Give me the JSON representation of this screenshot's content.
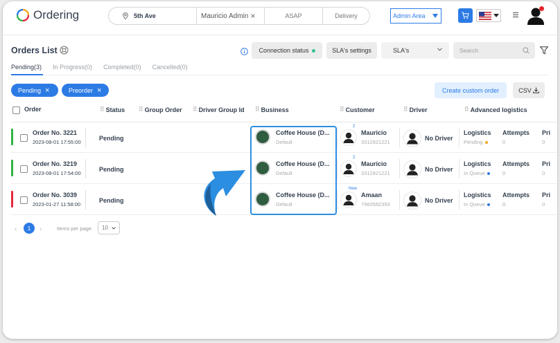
{
  "app": {
    "name": "Ordering"
  },
  "searchbar": {
    "address": "5th Ave",
    "user": "Mauricio Admin",
    "time": "ASAP",
    "delivery": "Delivery"
  },
  "admin_area": {
    "label": "Admin Area"
  },
  "page": {
    "title": "Orders List",
    "connection_status": "Connection status",
    "sla_settings": "SLA's settings",
    "sla_select": "SLA's",
    "search_placeholder": "Search"
  },
  "tabs": [
    {
      "label": "Pending(3)",
      "active": true
    },
    {
      "label": "In Progress(0)",
      "active": false
    },
    {
      "label": "Completed(0)",
      "active": false
    },
    {
      "label": "Cancelled(0)",
      "active": false
    }
  ],
  "chips": [
    "Pending",
    "Preorder"
  ],
  "actions": {
    "custom_order": "Create custom order",
    "csv": "CSV"
  },
  "columns": {
    "order": "Order",
    "status": "Status",
    "group_order": "Group Order",
    "driver_group": "Driver Group Id",
    "business": "Business",
    "customer": "Customer",
    "driver": "Driver",
    "logistics": "Advanced logistics"
  },
  "rows": [
    {
      "order_no": "Order No. 3221",
      "date": "2023-08-01 17:55:00",
      "status": "Pending",
      "status_color": "#2fb344",
      "business": "Coffee House (D...",
      "business_sub": "Default",
      "customer_badge": "2",
      "customer": "Mauricio",
      "phone": "3312921221",
      "driver": "No Driver",
      "logistics": "Logistics",
      "logistics_status": "Pending",
      "logistics_color": "#f5a623",
      "attempts": "Attempts",
      "attempts_val": "0",
      "priority": "Pri",
      "priority_val": "0"
    },
    {
      "order_no": "Order No. 3219",
      "date": "2023-08-01 17:54:00",
      "status": "Pending",
      "status_color": "#2fb344",
      "business": "Coffee House (D...",
      "business_sub": "Default",
      "customer_badge": "2",
      "customer": "Mauricio",
      "phone": "3312921221",
      "driver": "No Driver",
      "logistics": "Logistics",
      "logistics_status": "In Queue",
      "logistics_color": "#2c7be5",
      "attempts": "Attempts",
      "attempts_val": "0",
      "priority": "Pri",
      "priority_val": "0"
    },
    {
      "order_no": "Order No. 3039",
      "date": "2023-01-27 11:58:00",
      "status": "Pending",
      "status_color": "#e5263b",
      "business": "Coffee House (D...",
      "business_sub": "Default",
      "customer_badge": "New",
      "customer": "Amaan",
      "phone": "7960582393",
      "driver": "No Driver",
      "logistics": "Logistics",
      "logistics_status": "In Queue",
      "logistics_color": "#2c7be5",
      "attempts": "Attempts",
      "attempts_val": "0",
      "priority": "Pri",
      "priority_val": "0"
    }
  ],
  "pagination": {
    "page": "1",
    "items_label": "Items per page",
    "per_page": "10"
  },
  "colors": {
    "accent": "#2c7be5",
    "highlight": "#2b8ee0"
  }
}
